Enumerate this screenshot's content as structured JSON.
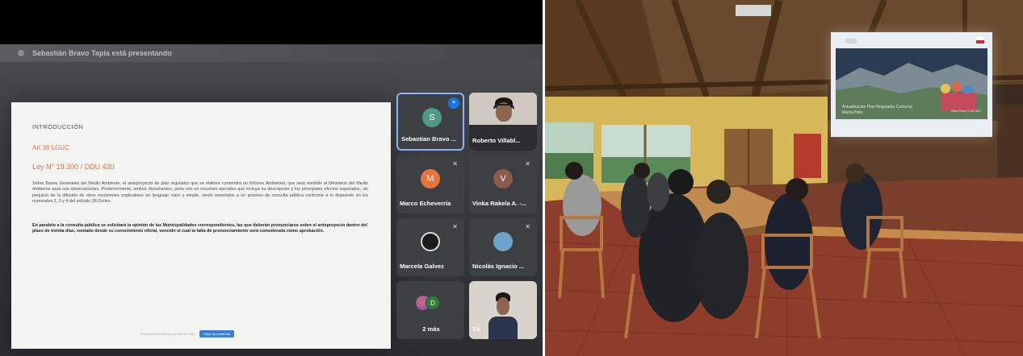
{
  "call": {
    "presenting_banner": "Sebastián Bravo Tapia está presentando",
    "slide": {
      "heading": "INTRODUCCIÓN",
      "article": "Art 36 LGUC",
      "law": "Ley N° 19.300 / DDU 430",
      "paragraph_1": "Sobre Bases Generales del Medio Ambiente, el anteproyecto de plan regulador que se elabore contendrá un Informe Ambiental, que será remitido al Ministerio del Medio Ambiente para sus observaciones. Posteriormente, ambos documentos, junto con un resumen ejecutivo que incluya su descripción y los principales efectos esperados, sin perjuicio de la difusión de otros resúmenes explicativos en lenguaje claro y simple, serán sometidos a un proceso de consulta pública conforme a lo dispuesto en los numerales 2, 3 y 4 del artículo 28 Octies.",
      "paragraph_2": "En paralelo a la consulta pública se solicitará la opinión de las Municipalidades correspondientes, las que deberán pronunciarse sobre el anteproyecto dentro del plazo de treinta días, contado desde su conocimiento oficial, vencido el cual la falta de pronunciamiento será considerada como aprobación.",
      "footer_left": "Estás presentando tu pantalla a todos",
      "footer_button": "Dejar de presentar"
    },
    "participants": [
      {
        "name": "Sebastian Bravo ...",
        "initial": "S",
        "color": "#4f9a82",
        "active": true
      },
      {
        "name": "Roberto Villabl...",
        "initial": "",
        "color": "",
        "active": false
      },
      {
        "name": "Marco Echeverría",
        "initial": "M",
        "color": "#e8743b",
        "active": false
      },
      {
        "name": "Vinka Rakela A. -...",
        "initial": "V",
        "color": "#8d5b4c",
        "active": false
      },
      {
        "name": "Marcela Galvez",
        "initial": "",
        "color": "",
        "active": false
      },
      {
        "name": "Nicolás Ignacio ...",
        "initial": "",
        "color": "",
        "active": false
      },
      {
        "name": "2 más",
        "initial": "D",
        "color": "#2f7d3b",
        "active": false
      },
      {
        "name": "Tú",
        "initial": "",
        "color": "",
        "active": false
      }
    ]
  },
  "projector": {
    "title_line_1": "Actualización Plan Regulador Comunal",
    "title_line_2": "María Pinto",
    "date": "María Pinto, 07-06-2022"
  }
}
